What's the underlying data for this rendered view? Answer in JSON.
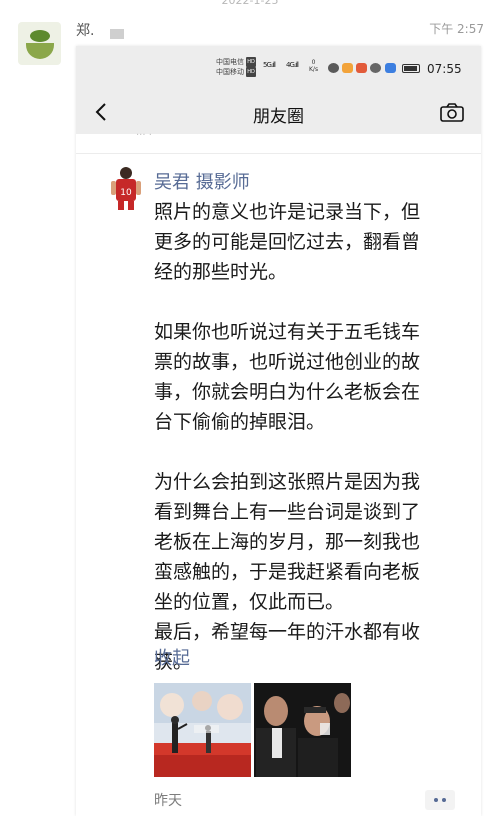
{
  "outer": {
    "date": "2022-1-25",
    "sender": "郑.",
    "time": "下午 2:57"
  },
  "status_bar": {
    "carrier_1": "中国电信",
    "carrier_2": "中国移动",
    "hd": "HD",
    "net_1": "5G",
    "net_2": "4G",
    "speed_value": "0",
    "speed_unit": "K/s",
    "clock": "07:55"
  },
  "nav": {
    "title": "朋友圈"
  },
  "post": {
    "author": "吴君 摄影师",
    "paragraphs": [
      [
        "照片的意义也许是记录当下，但",
        "更多的可能是回忆过去，翻看曾",
        "经的那些时光。"
      ],
      [
        "如果你也听说过有关于五毛钱车",
        "票的故事，也听说过他创业的故",
        "事，你就会明白为什么老板会在",
        "台下偷偷的掉眼泪。"
      ],
      [
        "为什么会拍到这张照片是因为我",
        "看到舞台上有一些台词是谈到了",
        "老板在上海的岁月，那一刻我也",
        "蛮感触的，于是我赶紧看向老板",
        "坐的位置，仅此而已。",
        "最后，希望每一年的汗水都有收",
        "获。"
      ]
    ],
    "collapse_label": "收起",
    "time_label": "昨天",
    "icons": {
      "back": "chevron-left-icon",
      "camera": "camera-icon",
      "more": "more-dots-icon"
    }
  },
  "colors": {
    "link_blue": "#576b95",
    "nav_bg": "#ededed",
    "text": "#1a1a1a"
  }
}
